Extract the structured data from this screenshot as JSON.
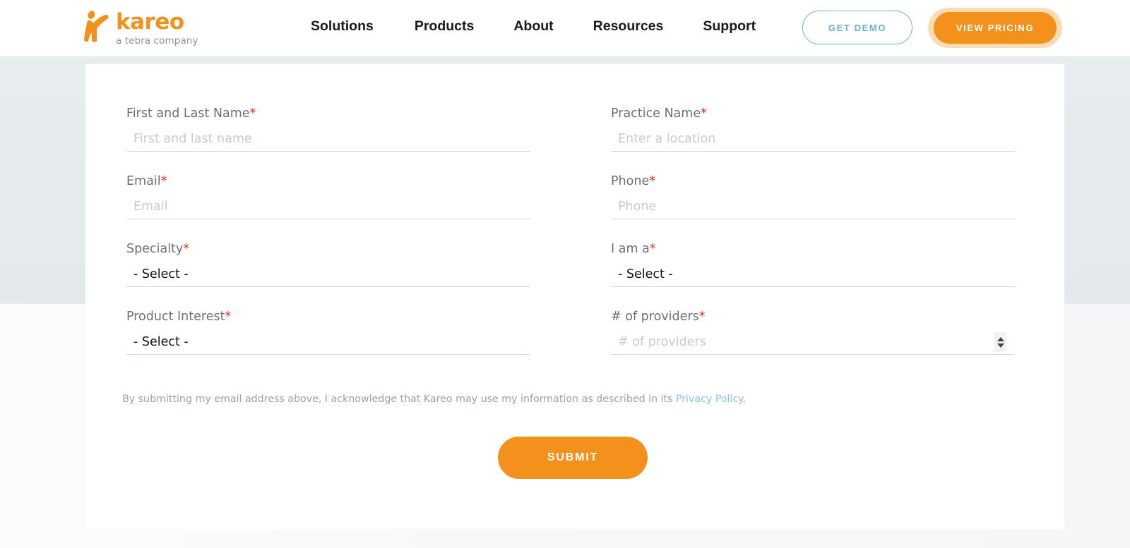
{
  "header": {
    "logo": {
      "mark": "kareo-person-icon",
      "word": "kareo",
      "tagline": "a tebra company"
    },
    "nav": [
      {
        "label": "Solutions"
      },
      {
        "label": "Products"
      },
      {
        "label": "About"
      },
      {
        "label": "Resources"
      },
      {
        "label": "Support"
      }
    ],
    "demo_button": "GET DEMO",
    "pricing_button": "VIEW PRICING"
  },
  "form": {
    "fields": [
      {
        "label": "First and Last Name",
        "required": "*",
        "type": "text",
        "placeholder": "First and last name",
        "value": ""
      },
      {
        "label": "Practice Name",
        "required": "*",
        "type": "text",
        "placeholder": "Enter a location",
        "value": ""
      },
      {
        "label": "Email",
        "required": "*",
        "type": "text",
        "placeholder": "Email",
        "value": ""
      },
      {
        "label": "Phone",
        "required": "*",
        "type": "text",
        "placeholder": "Phone",
        "value": ""
      },
      {
        "label": "Specialty",
        "required": "*",
        "type": "select",
        "placeholder": "",
        "value": "- Select -"
      },
      {
        "label": "I am a",
        "required": "*",
        "type": "select",
        "placeholder": "",
        "value": "- Select -"
      },
      {
        "label": "Product Interest",
        "required": "*",
        "type": "select",
        "placeholder": "",
        "value": "- Select -"
      },
      {
        "label": "# of providers",
        "required": "*",
        "type": "number",
        "placeholder": "# of providers",
        "value": ""
      }
    ],
    "disclaimer": {
      "text_before": "By submitting my email address above, I acknowledge that Kareo may use my information as described in its ",
      "link": "Privacy Policy",
      "text_after": "."
    },
    "submit_label": "SUBMIT"
  },
  "colors": {
    "brand_orange": "#f2921d",
    "link_blue": "#87c3e0",
    "required_red": "#ef2b12",
    "label_gray": "#6b7276",
    "placeholder_gray": "#c3cdd3",
    "underline": "#ccd8dd",
    "page_bg_top": "#e4eaee",
    "page_bg_bottom": "#f7f9f9"
  }
}
